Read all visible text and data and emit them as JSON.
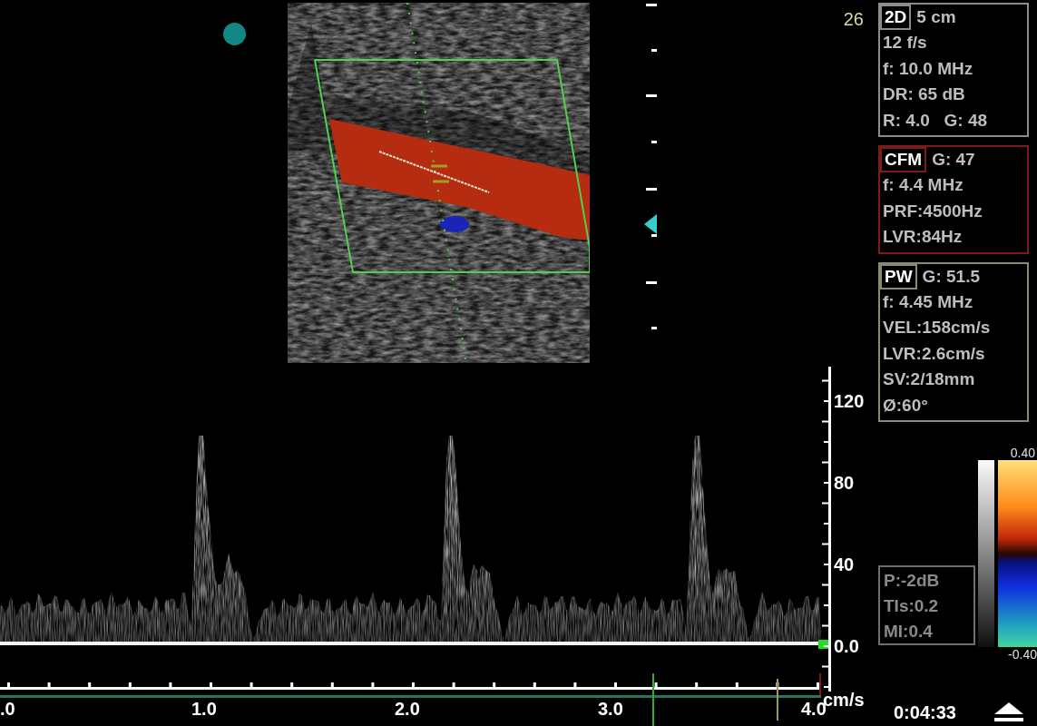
{
  "frame_counter": "26",
  "parameter_panels": [
    {
      "mode": "2D",
      "header_value": "5 cm",
      "color": "#8c8c8c",
      "lines": [
        "12 f/s",
        "f: 10.0 MHz",
        "DR: 65 dB",
        "R: 4.0   G: 48"
      ]
    },
    {
      "mode": "CFM",
      "header_value": "G: 47",
      "color": "#7a1c1c",
      "lines": [
        "f: 4.4 MHz",
        "PRF:4500Hz",
        "LVR:84Hz"
      ]
    },
    {
      "mode": "PW",
      "header_value": "G: 51.5",
      "color": "#8a8a72",
      "lines": [
        "f: 4.45 MHz",
        "VEL:158cm/s",
        "LVR:2.6cm/s",
        "SV:2/18mm",
        "Ø:60°"
      ]
    }
  ],
  "velocity_scale": {
    "labels": [
      "120",
      "80",
      "40",
      "0.0"
    ],
    "unit": "cm/s"
  },
  "time_scale": {
    "labels": [
      ".0",
      "1.0",
      "2.0",
      "3.0",
      "4.0"
    ]
  },
  "output_panel": {
    "lines": [
      "P:-2dB",
      "TIs:0.2",
      "MI:0.4"
    ]
  },
  "color_scale": {
    "max": "0.40",
    "min": "-0.40"
  },
  "elapsed_time": "0:04:33"
}
